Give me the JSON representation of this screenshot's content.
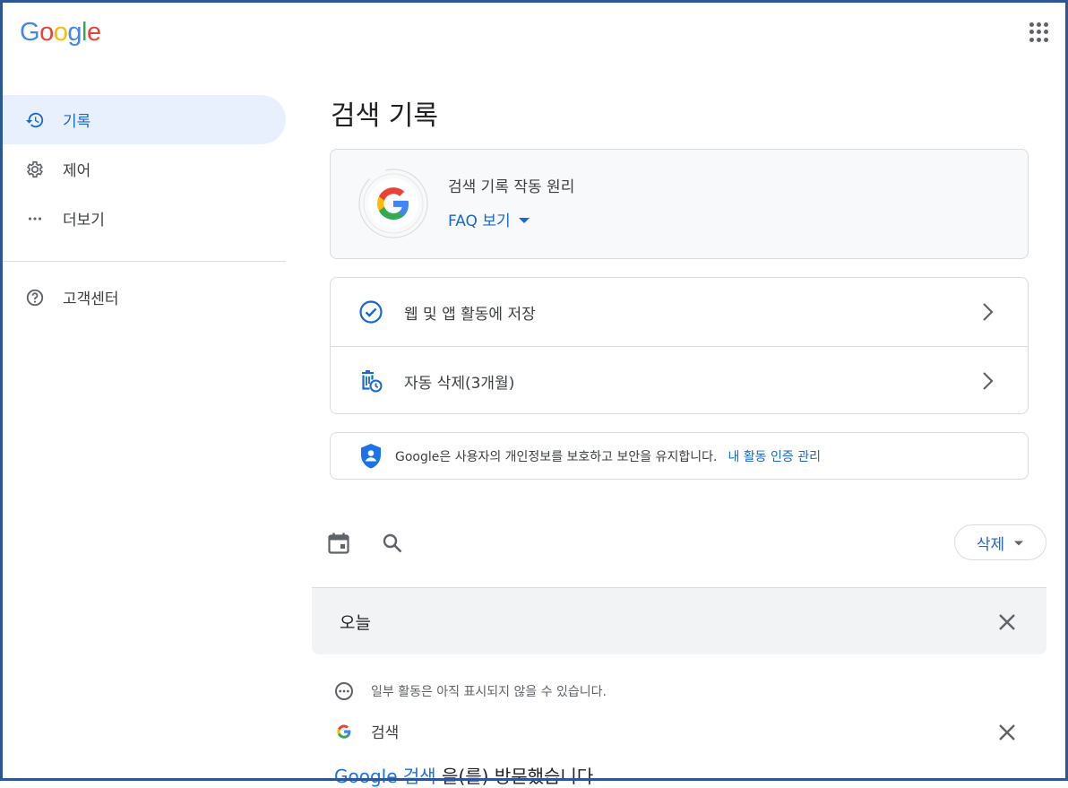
{
  "header": {
    "logo": [
      "G",
      "o",
      "o",
      "g",
      "l",
      "e"
    ],
    "logo_colors": [
      "#4285f4",
      "#ea4335",
      "#fbbc05",
      "#4285f4",
      "#34a853",
      "#ea4335"
    ],
    "apps_icon": "apps-grid-icon"
  },
  "sidebar": {
    "items": [
      {
        "label": "기록",
        "icon": "history-icon",
        "active": true
      },
      {
        "label": "제어",
        "icon": "gear-icon",
        "active": false
      },
      {
        "label": "더보기",
        "icon": "more-horiz-icon",
        "active": false
      }
    ],
    "help": {
      "label": "고객센터",
      "icon": "help-icon"
    }
  },
  "main": {
    "title": "검색 기록",
    "faq": {
      "title": "검색 기록 작동 원리",
      "link": "FAQ 보기"
    },
    "settings": [
      {
        "label": "웹 및 앱 활동에 저장",
        "icon": "check-circle-icon"
      },
      {
        "label": "자동 삭제(3개월)",
        "icon": "auto-delete-icon"
      }
    ],
    "privacy": {
      "text": "Google은 사용자의 개인정보를 보호하고 보안을 유지합니다.",
      "link": "내 활동 인증 관리"
    },
    "toolbar": {
      "delete_label": "삭제"
    },
    "today_label": "오늘",
    "notice": "일부 활동은 아직 표시되지 않을 수 있습니다.",
    "item": {
      "label": "검색"
    },
    "visit": {
      "prefix": "Google",
      "link": "검색",
      "suffix": " 을(를) 방문했습니다"
    }
  },
  "colors": {
    "accent": "#1967d2",
    "active_bg": "#e8f0fe",
    "border": "#dadce0"
  }
}
